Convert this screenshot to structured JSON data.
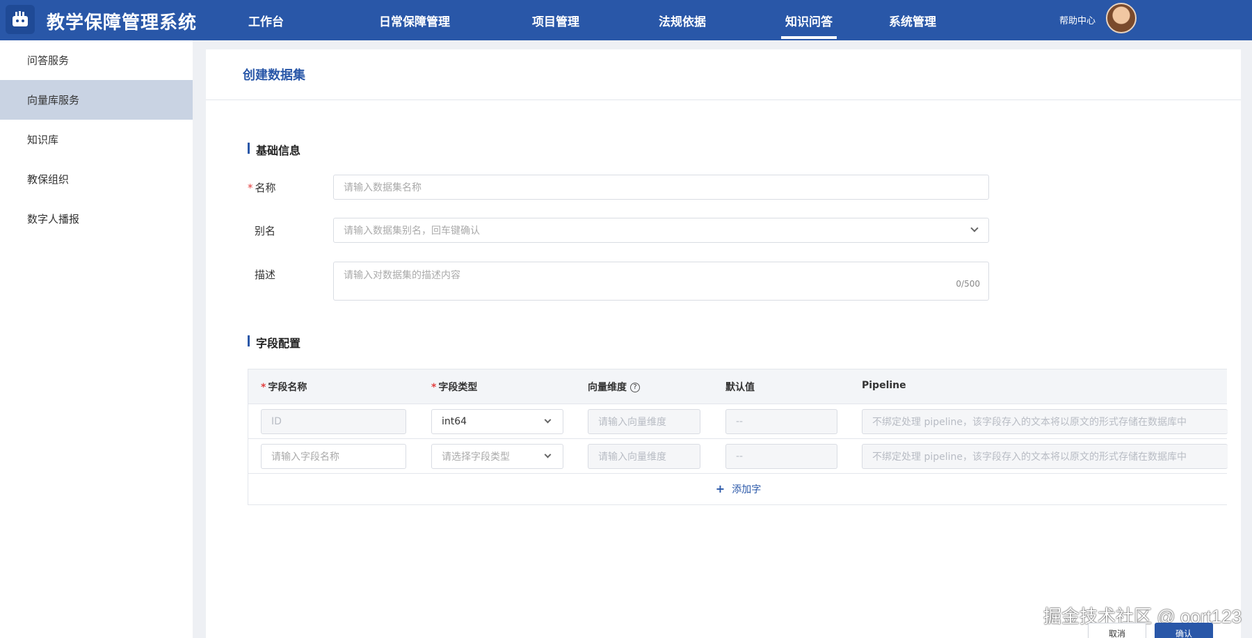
{
  "header": {
    "app_title": "教学保障管理系统",
    "nav": [
      "工作台",
      "日常保障管理",
      "项目管理",
      "法规依据",
      "知识问答",
      "系统管理"
    ],
    "active_nav": "知识问答",
    "help": "帮助中心"
  },
  "sidebar": {
    "items": [
      "问答服务",
      "向量库服务",
      "知识库",
      "教保组织",
      "数字人播报"
    ],
    "active": "向量库服务"
  },
  "page": {
    "title": "创建数据集"
  },
  "basic_info": {
    "section_title": "基础信息",
    "name_label": "名称",
    "name_placeholder": "请输入数据集名称",
    "alias_label": "别名",
    "alias_placeholder": "请输入数据集别名，回车键确认",
    "desc_label": "描述",
    "desc_placeholder": "请输入对数据集的描述内容",
    "desc_counter": "0/500"
  },
  "fields": {
    "section_title": "字段配置",
    "columns": [
      "字段名称",
      "字段类型",
      "向量维度",
      "默认值",
      "Pipeline"
    ],
    "rows": [
      {
        "name": "ID",
        "type": "int64",
        "dim_placeholder": "请输入向量维度",
        "default": "--",
        "pipeline_placeholder": "不绑定处理 pipeline，该字段存入的文本将以原文的形式存储在数据库中"
      },
      {
        "name_placeholder": "请输入字段名称",
        "type_placeholder": "请选择字段类型",
        "dim_placeholder": "请输入向量维度",
        "default": "--",
        "pipeline_placeholder": "不绑定处理 pipeline，该字段存入的文本将以原文的形式存储在数据库中"
      }
    ],
    "add_label": "添加字"
  },
  "actions": {
    "cancel": "取消",
    "confirm": "确认"
  },
  "watermark": "掘金技术社区 @ oort123",
  "colors": {
    "primary": "#2957a8",
    "sidebar_active": "#c9d3e3",
    "required": "#e24040"
  }
}
